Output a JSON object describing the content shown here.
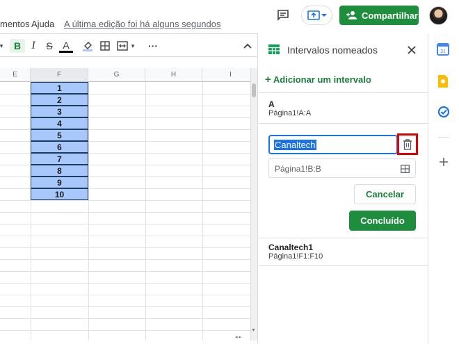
{
  "menu": {
    "items": [
      "mentos",
      "Ajuda"
    ],
    "last_edit": "A última edição foi há alguns segundos"
  },
  "header": {
    "share_label": "Compartilhar"
  },
  "toolbar": {
    "bold": "B",
    "italic": "I",
    "strike": "S",
    "text_color": "A",
    "more": "···"
  },
  "grid": {
    "columns": [
      "E",
      "F",
      "G",
      "H",
      "I"
    ],
    "selected_values": [
      "1",
      "2",
      "3",
      "4",
      "5",
      "6",
      "7",
      "8",
      "9",
      "10"
    ]
  },
  "panel": {
    "title": "Intervalos nomeados",
    "add_range": "Adicionar um intervalo",
    "ranges_top": [
      {
        "name": "A",
        "ref": "Página1!A:A"
      }
    ],
    "edit": {
      "name_value": "Canaltech",
      "range_value": "Página1!B:B",
      "cancel_label": "Cancelar",
      "done_label": "Concluído"
    },
    "ranges_bottom": [
      {
        "name": "Canaltech1",
        "ref": "Página1!F1:F10"
      }
    ]
  },
  "colors": {
    "accent_green": "#1e8e3e",
    "selection_blue": "#a8c7fa",
    "highlight_red": "#e00000"
  }
}
